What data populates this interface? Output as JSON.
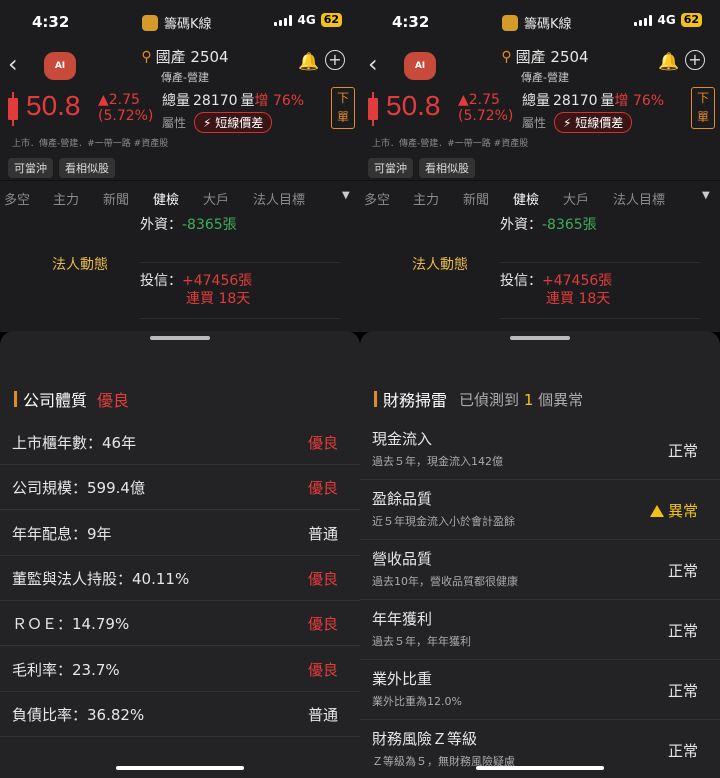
{
  "status_bar": {
    "time": "4:32",
    "app_name": "籌碼K線",
    "network": "4G",
    "battery": "62"
  },
  "header": {
    "stock_title": "國產 2504",
    "stock_sub": "傳產-營建",
    "price": "50.8",
    "change": "▲2.75",
    "change_pct": "(5.72%)",
    "volume_label": "總量",
    "volume_value": "28170",
    "volume_unit": "量",
    "volume_increase": "增 76%",
    "attr_label": "屬性",
    "attr_badge": "短線價差",
    "sell_button": "下單",
    "tags_line": "上市．傳產-營建．#一帶一路 #資產股",
    "chips": [
      "可當沖",
      "看相似股"
    ]
  },
  "tabs": [
    "多空",
    "主力",
    "新聞",
    "健檢",
    "大戶",
    "法人目標"
  ],
  "institutional": {
    "label": "法人動態",
    "foreign_label": "外資：",
    "foreign_value": "-8365張",
    "trust_label": "投信：",
    "trust_value": "+47456張",
    "trust_detail": "連買 18天"
  },
  "quality_sheet": {
    "title": "公司體質",
    "rating": "優良",
    "rows": [
      {
        "label": "上市櫃年數：46年",
        "result": "優良",
        "color": "red"
      },
      {
        "label": "公司規模：599.4億",
        "result": "優良",
        "color": "red"
      },
      {
        "label": "年年配息：9年",
        "result": "普通",
        "color": "white"
      },
      {
        "label": "董監與法人持股：40.11%",
        "result": "優良",
        "color": "red"
      },
      {
        "label": "ＲＯＥ：14.79%",
        "result": "優良",
        "color": "red"
      },
      {
        "label": "毛利率：23.7%",
        "result": "優良",
        "color": "red"
      },
      {
        "label": "負債比率：36.82%",
        "result": "普通",
        "color": "white"
      }
    ]
  },
  "finance_sheet": {
    "title": "財務掃雷",
    "detected_prefix": "已偵測到",
    "detected_count": "1",
    "detected_suffix": "個異常",
    "rows": [
      {
        "label": "現金流入",
        "desc": "過去５年，現金流入142億",
        "result": "正常",
        "warn": false
      },
      {
        "label": "盈餘品質",
        "desc": "近５年現金流入小於會計盈餘",
        "result": "異常",
        "warn": true
      },
      {
        "label": "營收品質",
        "desc": "過去10年，營收品質都很健康",
        "result": "正常",
        "warn": false
      },
      {
        "label": "年年獲利",
        "desc": "過去５年，年年獲利",
        "result": "正常",
        "warn": false
      },
      {
        "label": "業外比重",
        "desc": "業外比重為12.0%",
        "result": "正常",
        "warn": false
      },
      {
        "label": "財務風險Ｚ等級",
        "desc": "Ｚ等級為５，無財務風險疑慮",
        "result": "正常",
        "warn": false
      }
    ]
  },
  "colors": {
    "up": "#e33b3b",
    "down": "#3fae5a",
    "accent": "#e08a2a",
    "warn": "#f3c11b"
  }
}
